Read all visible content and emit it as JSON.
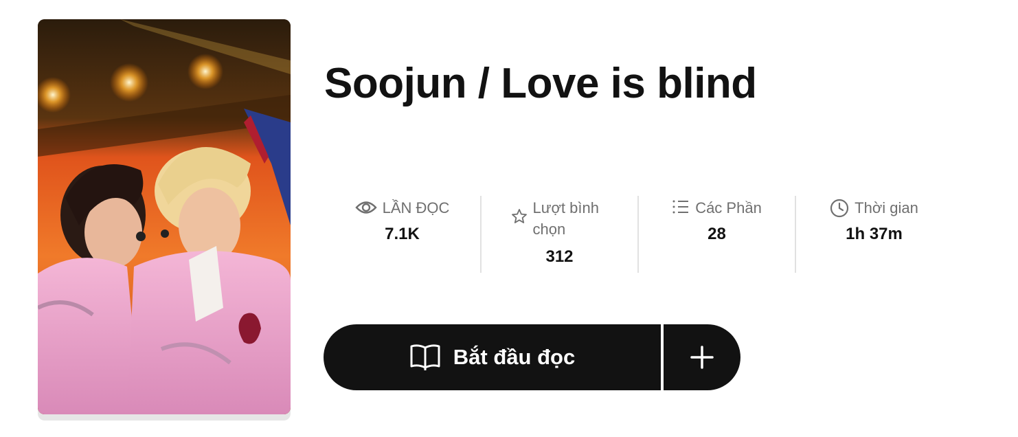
{
  "story": {
    "title": "Soojun / Love is blind"
  },
  "stats": [
    {
      "icon": "eye-icon",
      "label": "LẦN ĐỌC",
      "value": "7.1K"
    },
    {
      "icon": "star-icon",
      "label": "Lượt bình chọn",
      "value": "312"
    },
    {
      "icon": "list-icon",
      "label": "Các Phần",
      "value": "28"
    },
    {
      "icon": "clock-icon",
      "label": "Thời gian",
      "value": "1h 37m"
    }
  ],
  "actions": {
    "read_label": "Bắt đầu đọc",
    "read_icon": "open-book-icon",
    "add_icon": "plus-icon"
  },
  "colors": {
    "button_bg": "#121212",
    "label_gray": "#6f6f6f",
    "divider": "#e1e1e1"
  }
}
